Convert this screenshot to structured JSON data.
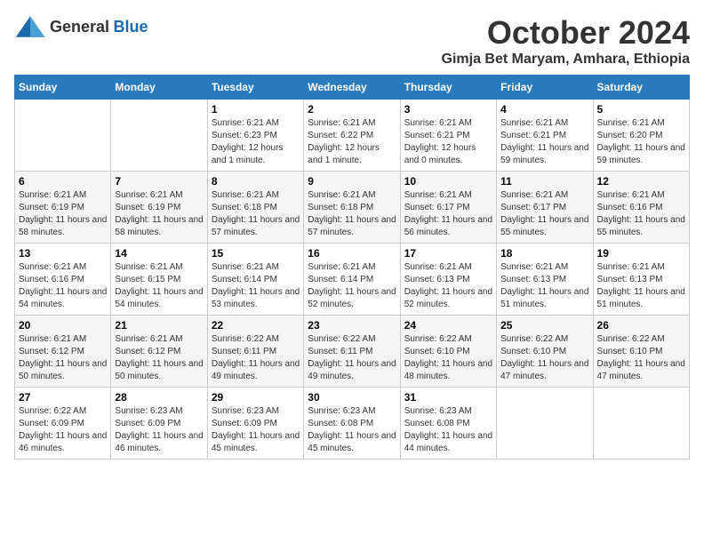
{
  "logo": {
    "general": "General",
    "blue": "Blue"
  },
  "title": {
    "month": "October 2024",
    "location": "Gimja Bet Maryam, Amhara, Ethiopia"
  },
  "header": {
    "days": [
      "Sunday",
      "Monday",
      "Tuesday",
      "Wednesday",
      "Thursday",
      "Friday",
      "Saturday"
    ]
  },
  "weeks": [
    {
      "days": [
        {
          "num": "",
          "info": ""
        },
        {
          "num": "",
          "info": ""
        },
        {
          "num": "1",
          "info": "Sunrise: 6:21 AM\nSunset: 6:23 PM\nDaylight: 12 hours and 1 minute."
        },
        {
          "num": "2",
          "info": "Sunrise: 6:21 AM\nSunset: 6:22 PM\nDaylight: 12 hours and 1 minute."
        },
        {
          "num": "3",
          "info": "Sunrise: 6:21 AM\nSunset: 6:21 PM\nDaylight: 12 hours and 0 minutes."
        },
        {
          "num": "4",
          "info": "Sunrise: 6:21 AM\nSunset: 6:21 PM\nDaylight: 11 hours and 59 minutes."
        },
        {
          "num": "5",
          "info": "Sunrise: 6:21 AM\nSunset: 6:20 PM\nDaylight: 11 hours and 59 minutes."
        }
      ]
    },
    {
      "days": [
        {
          "num": "6",
          "info": "Sunrise: 6:21 AM\nSunset: 6:19 PM\nDaylight: 11 hours and 58 minutes."
        },
        {
          "num": "7",
          "info": "Sunrise: 6:21 AM\nSunset: 6:19 PM\nDaylight: 11 hours and 58 minutes."
        },
        {
          "num": "8",
          "info": "Sunrise: 6:21 AM\nSunset: 6:18 PM\nDaylight: 11 hours and 57 minutes."
        },
        {
          "num": "9",
          "info": "Sunrise: 6:21 AM\nSunset: 6:18 PM\nDaylight: 11 hours and 57 minutes."
        },
        {
          "num": "10",
          "info": "Sunrise: 6:21 AM\nSunset: 6:17 PM\nDaylight: 11 hours and 56 minutes."
        },
        {
          "num": "11",
          "info": "Sunrise: 6:21 AM\nSunset: 6:17 PM\nDaylight: 11 hours and 55 minutes."
        },
        {
          "num": "12",
          "info": "Sunrise: 6:21 AM\nSunset: 6:16 PM\nDaylight: 11 hours and 55 minutes."
        }
      ]
    },
    {
      "days": [
        {
          "num": "13",
          "info": "Sunrise: 6:21 AM\nSunset: 6:16 PM\nDaylight: 11 hours and 54 minutes."
        },
        {
          "num": "14",
          "info": "Sunrise: 6:21 AM\nSunset: 6:15 PM\nDaylight: 11 hours and 54 minutes."
        },
        {
          "num": "15",
          "info": "Sunrise: 6:21 AM\nSunset: 6:14 PM\nDaylight: 11 hours and 53 minutes."
        },
        {
          "num": "16",
          "info": "Sunrise: 6:21 AM\nSunset: 6:14 PM\nDaylight: 11 hours and 52 minutes."
        },
        {
          "num": "17",
          "info": "Sunrise: 6:21 AM\nSunset: 6:13 PM\nDaylight: 11 hours and 52 minutes."
        },
        {
          "num": "18",
          "info": "Sunrise: 6:21 AM\nSunset: 6:13 PM\nDaylight: 11 hours and 51 minutes."
        },
        {
          "num": "19",
          "info": "Sunrise: 6:21 AM\nSunset: 6:13 PM\nDaylight: 11 hours and 51 minutes."
        }
      ]
    },
    {
      "days": [
        {
          "num": "20",
          "info": "Sunrise: 6:21 AM\nSunset: 6:12 PM\nDaylight: 11 hours and 50 minutes."
        },
        {
          "num": "21",
          "info": "Sunrise: 6:21 AM\nSunset: 6:12 PM\nDaylight: 11 hours and 50 minutes."
        },
        {
          "num": "22",
          "info": "Sunrise: 6:22 AM\nSunset: 6:11 PM\nDaylight: 11 hours and 49 minutes."
        },
        {
          "num": "23",
          "info": "Sunrise: 6:22 AM\nSunset: 6:11 PM\nDaylight: 11 hours and 49 minutes."
        },
        {
          "num": "24",
          "info": "Sunrise: 6:22 AM\nSunset: 6:10 PM\nDaylight: 11 hours and 48 minutes."
        },
        {
          "num": "25",
          "info": "Sunrise: 6:22 AM\nSunset: 6:10 PM\nDaylight: 11 hours and 47 minutes."
        },
        {
          "num": "26",
          "info": "Sunrise: 6:22 AM\nSunset: 6:10 PM\nDaylight: 11 hours and 47 minutes."
        }
      ]
    },
    {
      "days": [
        {
          "num": "27",
          "info": "Sunrise: 6:22 AM\nSunset: 6:09 PM\nDaylight: 11 hours and 46 minutes."
        },
        {
          "num": "28",
          "info": "Sunrise: 6:23 AM\nSunset: 6:09 PM\nDaylight: 11 hours and 46 minutes."
        },
        {
          "num": "29",
          "info": "Sunrise: 6:23 AM\nSunset: 6:09 PM\nDaylight: 11 hours and 45 minutes."
        },
        {
          "num": "30",
          "info": "Sunrise: 6:23 AM\nSunset: 6:08 PM\nDaylight: 11 hours and 45 minutes."
        },
        {
          "num": "31",
          "info": "Sunrise: 6:23 AM\nSunset: 6:08 PM\nDaylight: 11 hours and 44 minutes."
        },
        {
          "num": "",
          "info": ""
        },
        {
          "num": "",
          "info": ""
        }
      ]
    }
  ]
}
